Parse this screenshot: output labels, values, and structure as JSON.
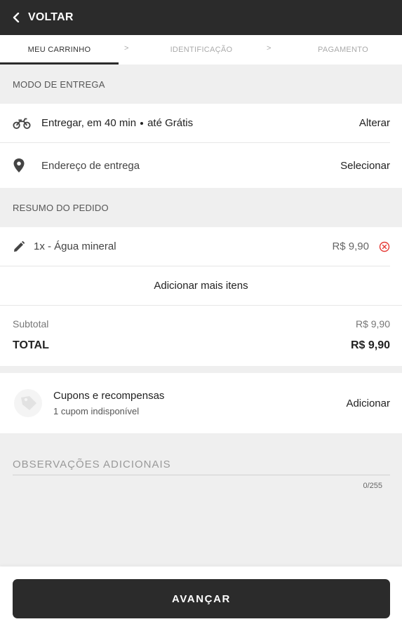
{
  "topbar": {
    "back_label": "VOLTAR"
  },
  "steps": [
    {
      "label": "MEU CARRINHO",
      "active": true
    },
    {
      "label": "IDENTIFICAÇÃO",
      "active": false
    },
    {
      "label": "PAGAMENTO",
      "active": false
    }
  ],
  "step_separator": ">",
  "delivery": {
    "section_title": "MODO DE ENTREGA",
    "mode_text_a": "Entregar, em 40 min",
    "mode_text_b": "até Grátis",
    "mode_action": "Alterar",
    "address_text": "Endereço de entrega",
    "address_action": "Selecionar",
    "icons": [
      "motorcycle-icon",
      "location-pin-icon"
    ]
  },
  "summary": {
    "section_title": "RESUMO DO PEDIDO",
    "items": [
      {
        "label": "1x - Água mineral",
        "price": "R$ 9,90"
      }
    ],
    "add_more_label": "Adicionar mais itens",
    "subtotal_label": "Subtotal",
    "subtotal_value": "R$ 9,90",
    "total_label": "TOTAL",
    "total_value": "R$ 9,90"
  },
  "coupons": {
    "title": "Cupons e recompensas",
    "subtitle": "1 cupom indisponível",
    "action": "Adicionar"
  },
  "observations": {
    "placeholder": "OBSERVAÇÕES ADICIONAIS",
    "counter": "0/255"
  },
  "footer": {
    "next_label": "AVANÇAR"
  },
  "colors": {
    "dark": "#2b2b2b",
    "remove": "#e53935",
    "background": "#efefef"
  }
}
